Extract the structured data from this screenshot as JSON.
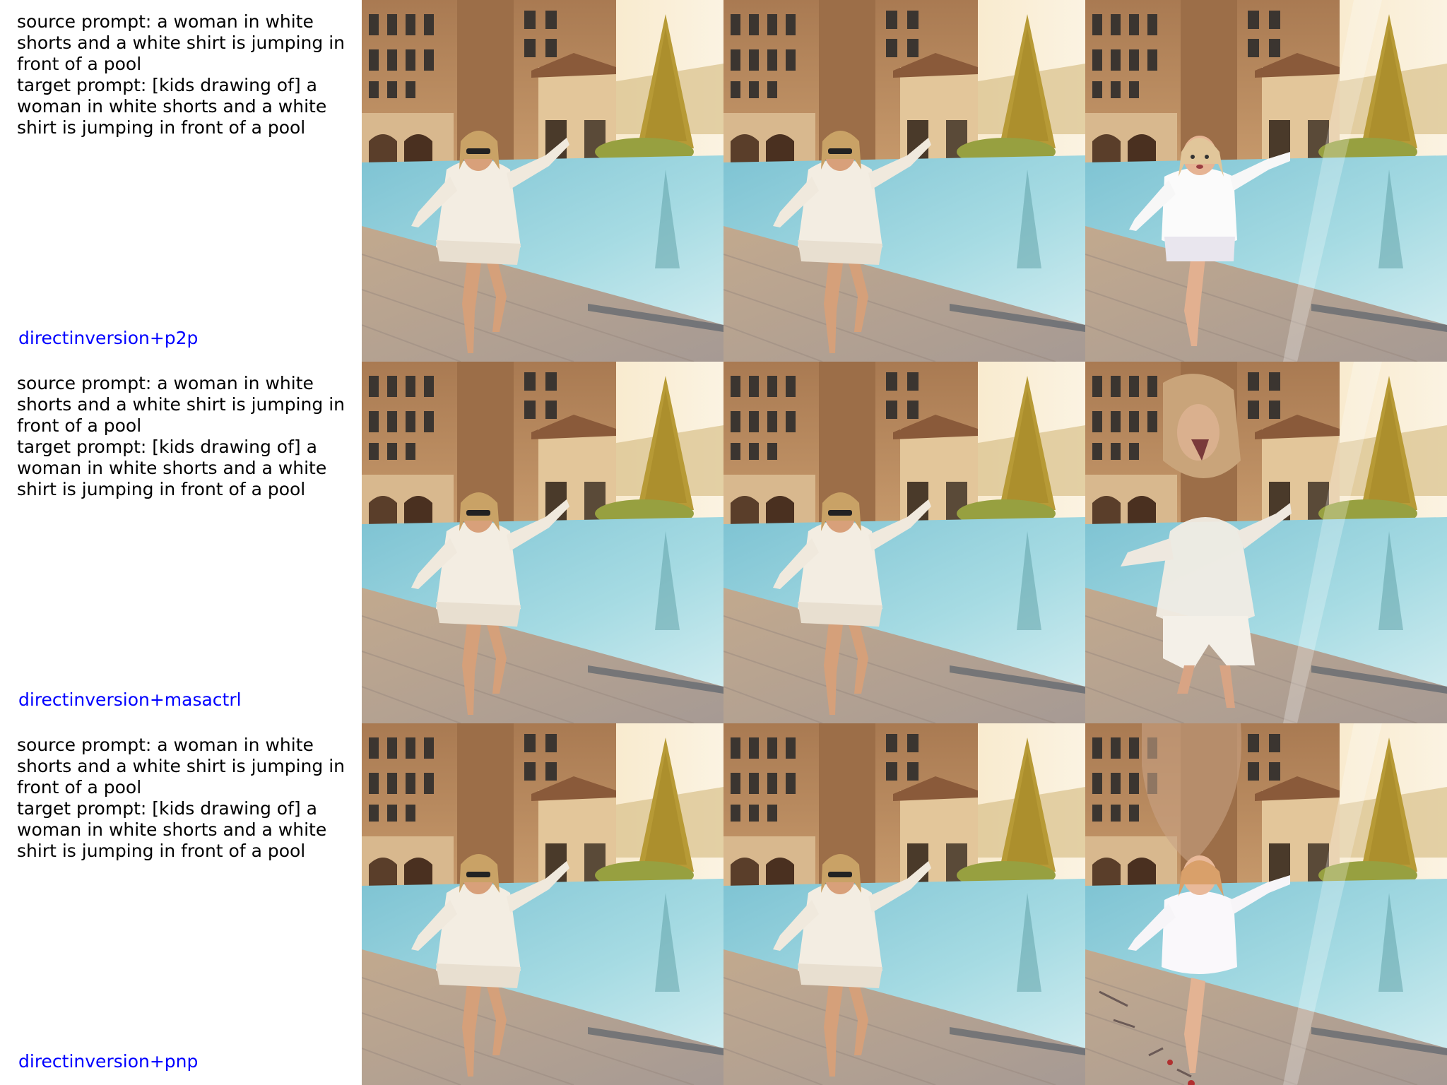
{
  "rows": [
    {
      "source_prompt": "source prompt: a woman in white\nshorts and a white shirt is jumping in\nfront of a pool",
      "target_prompt": "target prompt: [kids drawing of] a\nwoman in white shorts and a white\nshirt is jumping in front of a pool",
      "method": "directinversion+p2p"
    },
    {
      "source_prompt": "source prompt: a woman in white\nshorts and a white shirt is jumping in\nfront of a pool",
      "target_prompt": "target prompt: [kids drawing of] a\nwoman in white shorts and a white\nshirt is jumping in front of a pool",
      "method": "directinversion+masactrl"
    },
    {
      "source_prompt": "source prompt: a woman in white\nshorts and a white shirt is jumping in\nfront of a pool",
      "target_prompt": "target prompt: [kids drawing of] a\nwoman in white shorts and a white\nshirt is jumping in front of a pool",
      "method": "directinversion+pnp"
    }
  ],
  "colors": {
    "method_label": "#0000ff",
    "prompt_text": "#000000",
    "sky": "#f6ead2",
    "building": "#b88a5c",
    "pool": "#8fd0dc",
    "deck": "#b7a594",
    "tree": "#b9a03a",
    "figure_shirt": "#f4efe4",
    "skin": "#d9a27a"
  }
}
